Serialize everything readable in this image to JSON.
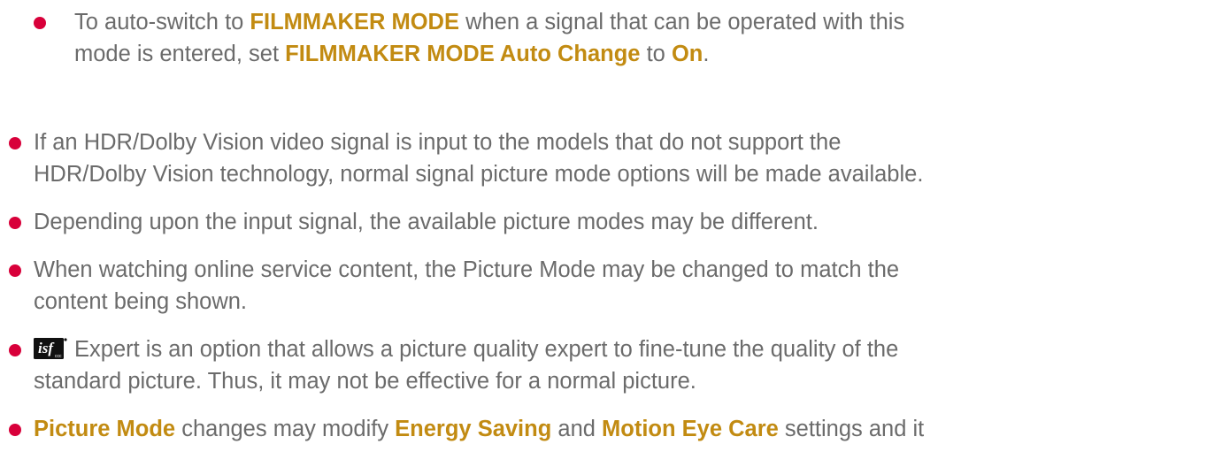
{
  "colors": {
    "bullet": "#d8003a",
    "highlight": "#c28b12",
    "text": "#6b6b6b"
  },
  "items": [
    {
      "line1": [
        {
          "t": "To auto-switch to ",
          "hl": false
        },
        {
          "t": "FILMMAKER MODE",
          "hl": true
        },
        {
          "t": " when a signal that can be operated with this",
          "hl": false
        }
      ],
      "line2": [
        {
          "t": "mode is entered, set ",
          "hl": false
        },
        {
          "t": "FILMMAKER MODE Auto Change",
          "hl": true
        },
        {
          "t": " to ",
          "hl": false
        },
        {
          "t": "On",
          "hl": true
        },
        {
          "t": ".",
          "hl": false
        }
      ]
    },
    {
      "line1": "If an HDR/Dolby Vision video signal is input to the models that do not support the",
      "line2": "HDR/Dolby Vision technology, normal signal picture mode options will be made available."
    },
    {
      "line1": "Depending upon the input signal, the available picture modes may be different."
    },
    {
      "line1": "When watching online service content, the Picture Mode may be changed to match the",
      "line2": "content being shown."
    },
    {
      "logo_icon": "isf-ccc-logo",
      "line1": "Expert is an option that allows a picture quality expert to fine-tune the quality of the",
      "line2": "standard picture. Thus, it may not be effective for a normal picture."
    },
    {
      "line1": [
        {
          "t": "Picture Mode",
          "hl": true
        },
        {
          "t": " changes may modify ",
          "hl": false
        },
        {
          "t": "Energy Saving",
          "hl": true
        },
        {
          "t": " and ",
          "hl": false
        },
        {
          "t": "Motion Eye Care",
          "hl": true
        },
        {
          "t": " settings and it",
          "hl": false
        }
      ]
    }
  ]
}
